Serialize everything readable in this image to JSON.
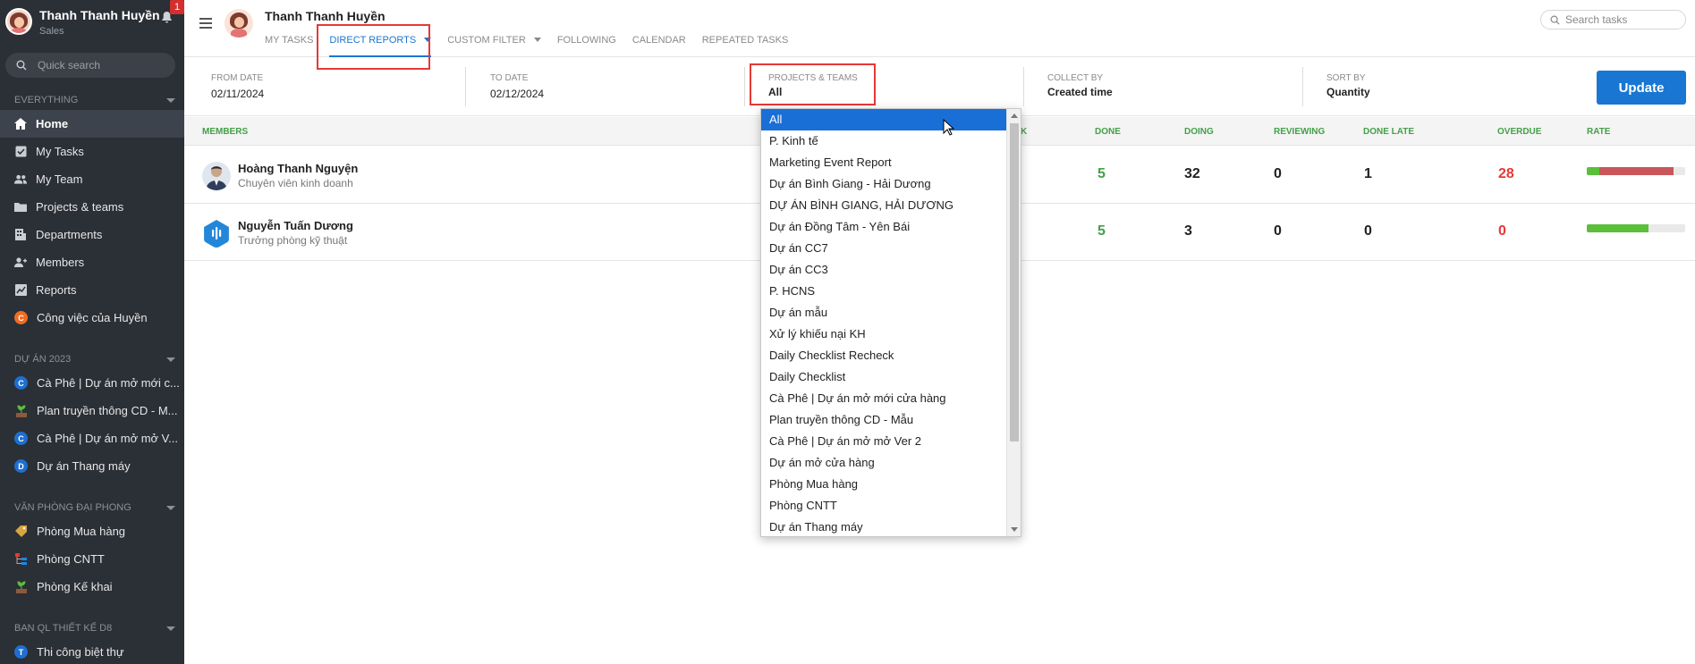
{
  "sidebar": {
    "user_name": "Thanh Thanh Huyền",
    "user_role": "Sales",
    "notification_count": "1",
    "search_placeholder": "Quick search",
    "section_everything": "EVERYTHING",
    "nav": [
      {
        "label": "Home",
        "icon": "home-icon"
      },
      {
        "label": "My Tasks",
        "icon": "checkbox-icon"
      },
      {
        "label": "My Team",
        "icon": "team-icon"
      },
      {
        "label": "Projects & teams",
        "icon": "folder-icon"
      },
      {
        "label": "Departments",
        "icon": "department-icon"
      },
      {
        "label": "Members",
        "icon": "members-icon"
      },
      {
        "label": "Reports",
        "icon": "chart-icon"
      },
      {
        "label": "Công việc của Huyền",
        "icon": "letter-c-icon",
        "letter": "C",
        "color": "#f26b21"
      }
    ],
    "section_2023": "DỰ ÁN 2023",
    "projects_2023": [
      {
        "label": "Cà Phê | Dự án mở mới c...",
        "letter": "C",
        "color": "#1e6fd0"
      },
      {
        "label": "Plan truyền thông CD - M...",
        "icon": "plant-icon"
      },
      {
        "label": "Cà Phê | Dự án mở mở V...",
        "letter": "C",
        "color": "#1e6fd0"
      },
      {
        "label": "Dự án Thang máy",
        "letter": "D",
        "color": "#1e6fd0"
      }
    ],
    "section_office": "VĂN PHÒNG ĐẠI PHONG",
    "office": [
      {
        "label": "Phòng Mua hàng",
        "icon": "tag-icon"
      },
      {
        "label": "Phòng CNTT",
        "icon": "hierarchy-icon"
      },
      {
        "label": "Phòng Kế khai",
        "icon": "plant-icon"
      }
    ],
    "section_d8": "BAN QL THIẾT KẾ D8",
    "d8": [
      {
        "label": "Thi công biệt thự",
        "letter": "T",
        "color": "#1e6fd0"
      }
    ]
  },
  "header": {
    "title": "Thanh Thanh Huyền",
    "tabs": [
      "MY TASKS",
      "DIRECT REPORTS",
      "CUSTOM FILTER",
      "FOLLOWING",
      "CALENDAR",
      "REPEATED TASKS"
    ],
    "active_tab": "DIRECT REPORTS",
    "search_placeholder": "Search tasks"
  },
  "filters": {
    "from_date_label": "FROM DATE",
    "from_date": "02/11/2024",
    "to_date_label": "TO DATE",
    "to_date": "02/12/2024",
    "projects_label": "PROJECTS & TEAMS",
    "projects_value": "All",
    "collect_label": "COLLECT BY",
    "collect_value": "Created time",
    "sort_label": "SORT BY",
    "sort_value": "Quantity",
    "update_label": "Update"
  },
  "table": {
    "columns": {
      "members": "MEMBERS",
      "task_partial": "K",
      "done": "DONE",
      "doing": "DOING",
      "reviewing": "REVIEWING",
      "done_late": "DONE LATE",
      "overdue": "OVERDUE",
      "rate": "RATE"
    },
    "rows": [
      {
        "name": "Hoàng Thanh Nguyện",
        "title": "Chuyên viên kinh doanh",
        "done": "5",
        "doing": "32",
        "reviewing": "0",
        "done_late": "1",
        "overdue": "28",
        "rate_done": 0.13,
        "rate_overdue": 0.75
      },
      {
        "name": "Nguyễn Tuấn Dương",
        "title": "Trưởng phòng kỹ thuật",
        "done": "5",
        "doing": "3",
        "reviewing": "0",
        "done_late": "0",
        "overdue": "0",
        "rate_done": 0.63,
        "rate_overdue": 0
      }
    ]
  },
  "dropdown": {
    "selected": "All",
    "options": [
      "All",
      "P. Kinh tế",
      "Marketing Event Report",
      "Dự án Bình Giang - Hải Dương",
      "DỰ ÁN BÌNH GIANG, HẢI DƯƠNG",
      "Dự án Đồng Tâm - Yên Bái",
      "Dự án CC7",
      "Dự án CC3",
      "P. HCNS",
      "Dự án mẫu",
      "Xử lý khiếu nại KH",
      "Daily Checklist Recheck",
      "Daily Checklist",
      "Cà Phê | Dự án mở mới cửa hàng",
      "Plan truyền thông CD - Mẫu",
      "Cà Phê | Dự án mở mở Ver 2",
      "Dự án mở cửa hàng",
      "Phòng Mua hàng",
      "Phòng CNTT",
      "Dự án Thang máy"
    ]
  },
  "colors": {
    "accent": "#1976d2",
    "sidebar_bg": "#2b2f36",
    "green": "#43a047",
    "red": "#e53935",
    "highlight_box": "#e53935"
  }
}
